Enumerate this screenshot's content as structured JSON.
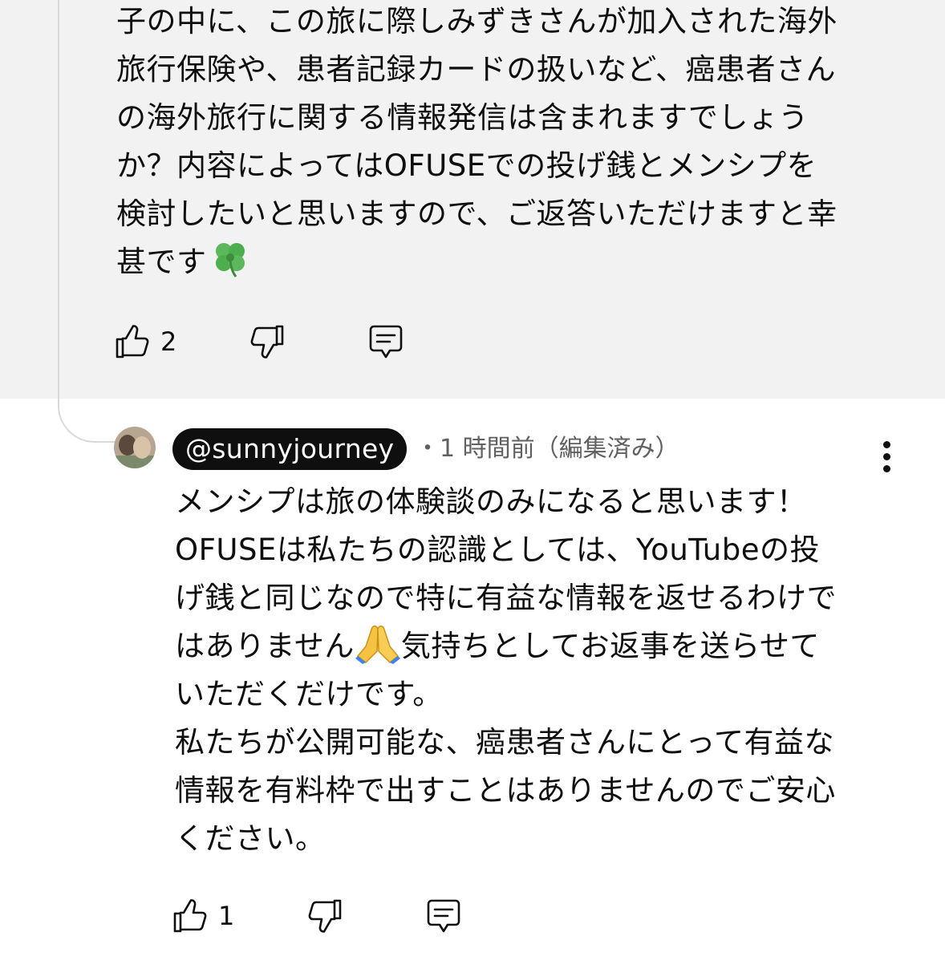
{
  "parent_comment": {
    "text_before_emoji": "子の中に、この旅に際しみずきさんが加入された海外\n旅行保険や、患者記録カードの扱いなど、癌患者さん\nの海外旅行に関する情報発信は含まれますでしょう\nか？内容によってはOFUSEでの投げ銭とメンシプを\n検討したいと思いますので、ご返答いただけますと幸\n甚です",
    "emoji": "four-leaf-clover",
    "like_count": "2"
  },
  "reply": {
    "author_handle": "@sunnyjourney",
    "meta": "・1 時間前（編集済み）",
    "text_part1": "メンシプは旅の体験談のみになると思います！\nOFUSEは私たちの認識としては、YouTubeの投\nげ銭と同じなので特に有益な情報を返せるわけで\nはありません",
    "emoji": "folded-hands",
    "text_part2": "気持ちとしてお返事を送らせて\nいただくだけです。\n私たちが公開可能な、癌患者さんにとって有益な\n情報を有料枠で出すことはありませんのでご安心\nください。",
    "like_count": "1"
  },
  "colors": {
    "highlight_bg": "#f2f2f2",
    "text": "#0f0f0f",
    "meta_text": "#606060",
    "chip_bg": "#0f0f0f",
    "chip_text": "#ffffff",
    "thread_line": "#d9d9d9"
  },
  "icons": [
    "thumbs-up-icon",
    "thumbs-down-icon",
    "reply-icon",
    "more-vert-icon"
  ]
}
